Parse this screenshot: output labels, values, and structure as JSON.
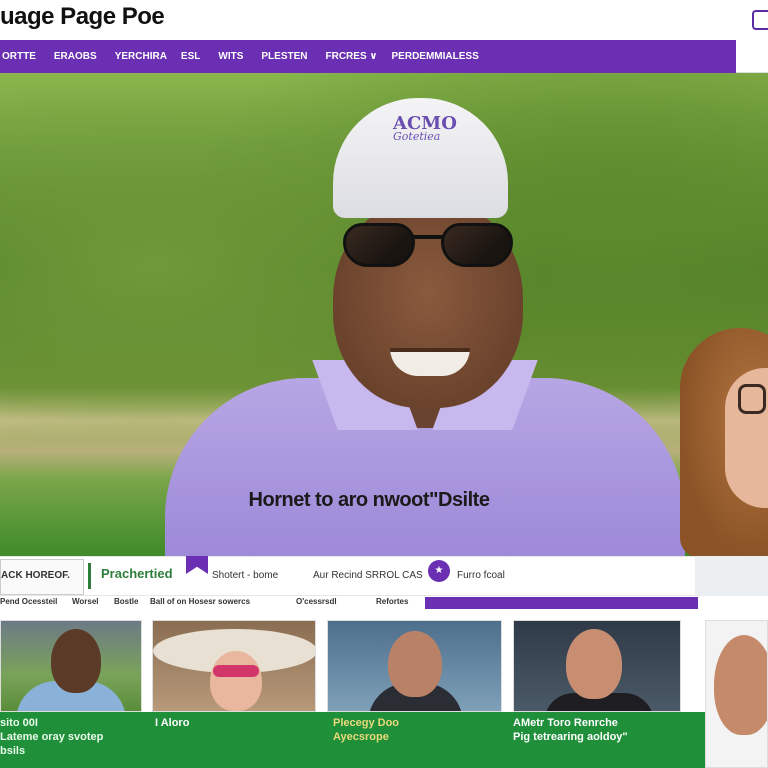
{
  "header": {
    "title": "uage Page Poe"
  },
  "nav": {
    "items": [
      {
        "label": "ORTTE"
      },
      {
        "label": "ERAOBS"
      },
      {
        "label": "YERCHIRA"
      },
      {
        "label": "ESL"
      },
      {
        "label": "WITS"
      },
      {
        "label": "PLESTEN"
      },
      {
        "label": "FRCRES ∨"
      },
      {
        "label": "PERDEMMIALESS"
      }
    ]
  },
  "hero": {
    "cap_text_main": "ACMO",
    "cap_text_sub": "Gotetiea",
    "caption": "Hornet to aro nwoot\"Dsilte"
  },
  "infobar": {
    "item0": "ACK HOREOF.",
    "item1": "Prachertied",
    "item2": "Shotert - bome",
    "item3": "Aur Recind SRROL CAS",
    "dot": "★",
    "item4": "Furro fcoal"
  },
  "subbar": {
    "items": [
      "Pend Ocessteil",
      "Worsel",
      "Bostle",
      "Ball of on Hosesr sowercs",
      "O'cessrsdl",
      "Refortes"
    ]
  },
  "cards": [
    {
      "caption_line1": "sito 00I",
      "caption_line2": "Lateme oray svotep",
      "caption_line3": "bsils"
    },
    {
      "caption_line1": "I  Aloro",
      "caption_line2": "",
      "caption_line3": ""
    },
    {
      "caption_line1": "Plecegy Doo",
      "caption_line2": "Ayecsrope",
      "caption_line3": ""
    },
    {
      "caption_line1": "AMetr Toro Renrche",
      "caption_line2": "Pig tetrearing aoldoy\"",
      "caption_line3": ""
    }
  ],
  "colors": {
    "brand_purple": "#6a2fb3",
    "accent_green": "#1f8f3a"
  }
}
